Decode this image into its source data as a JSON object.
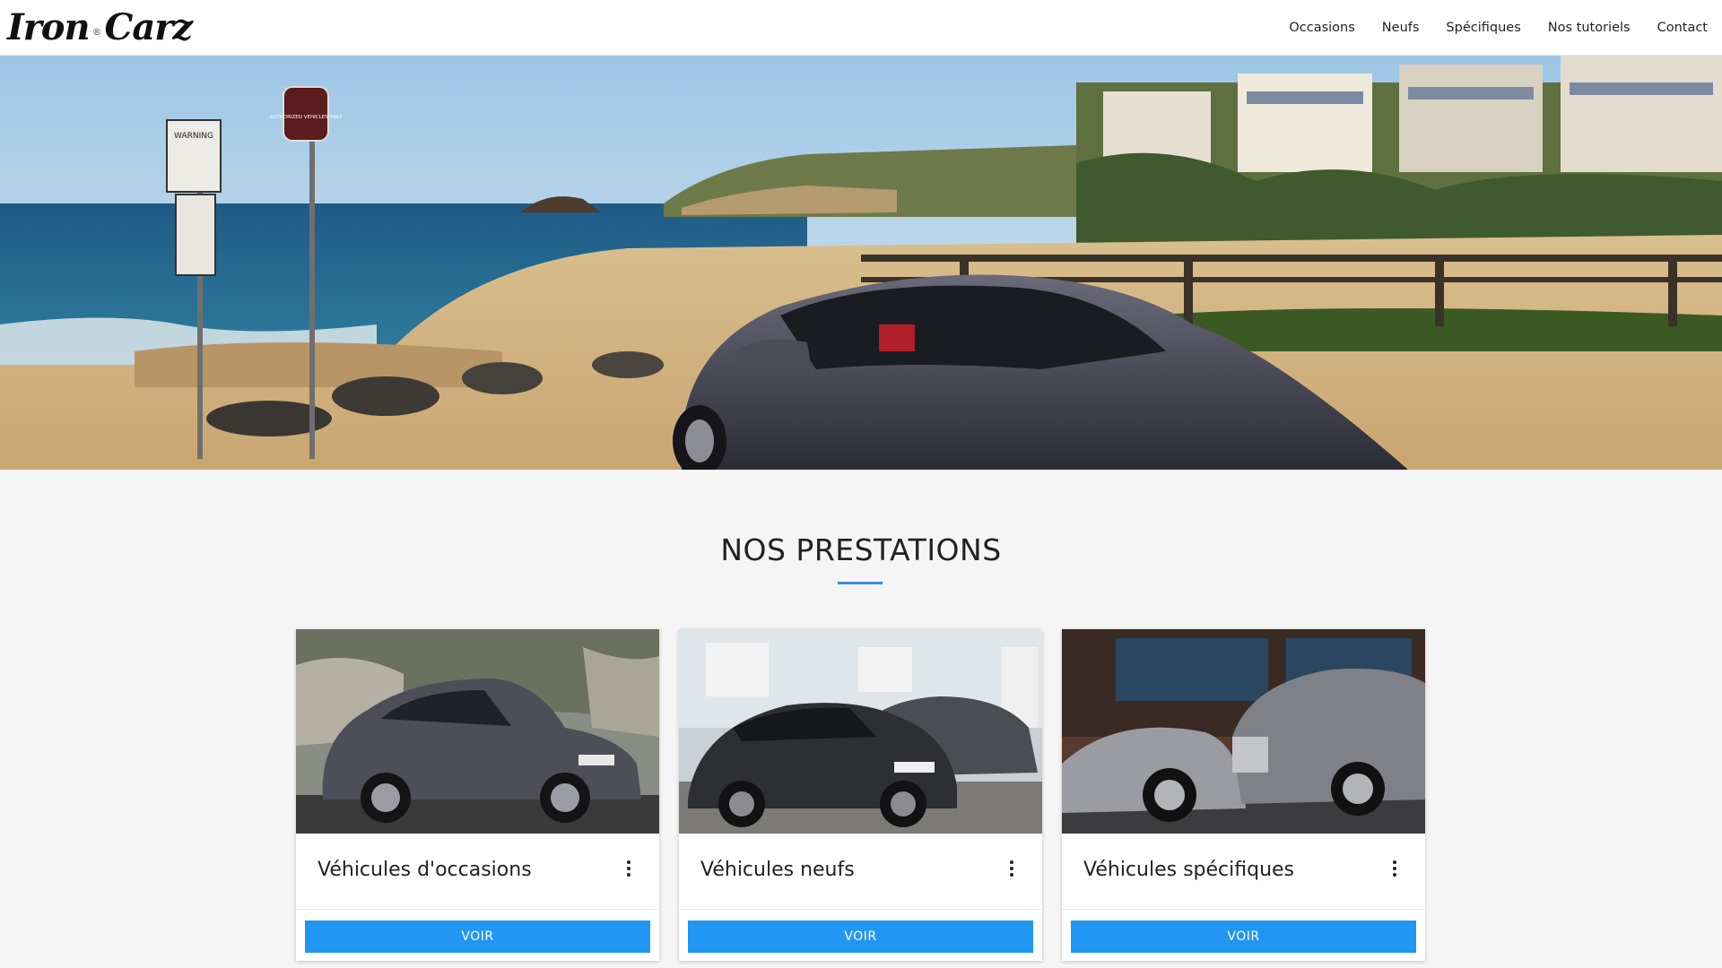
{
  "brand": {
    "logo_left": "Iron",
    "logo_mark": "®",
    "logo_right": "Carz"
  },
  "nav": {
    "items": [
      {
        "label": "Occasions"
      },
      {
        "label": "Neufs"
      },
      {
        "label": "Spécifiques"
      },
      {
        "label": "Nos tutoriels"
      },
      {
        "label": "Contact"
      }
    ]
  },
  "hero": {
    "sign_1": "WARNING",
    "sign_2": "AUTHORIZED VEHICLES ONLY"
  },
  "section": {
    "title": "NOS PRESTATIONS",
    "accent_color": "#3b8dde"
  },
  "cards": [
    {
      "title": "Véhicules d'occasions",
      "button": "VOIR",
      "menu_icon": "more-vert-icon"
    },
    {
      "title": "Véhicules neufs",
      "button": "VOIR",
      "menu_icon": "more-vert-icon"
    },
    {
      "title": "Véhicules spécifiques",
      "button": "VOIR",
      "menu_icon": "more-vert-icon"
    }
  ],
  "colors": {
    "button": "#2196f3",
    "page_background": "#f5f5f5"
  }
}
